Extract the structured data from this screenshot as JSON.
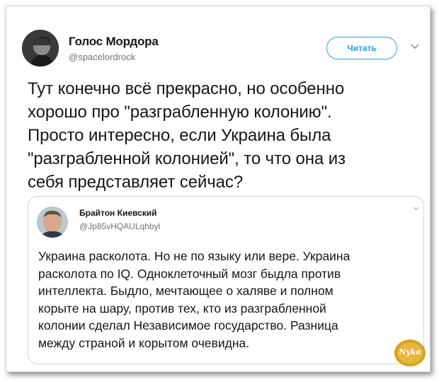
{
  "tweet": {
    "author_name": "Голос Мордора",
    "author_handle": "@spacelordrock",
    "follow_label": "Читать",
    "text": "Тут конечно всё прекрасно, но особенно\nхорошо про \"разграбленную колонию\".\nПросто интересно, если Украина была\n\"разграбленной колонией\", то что она из\nсебя представляет сейчас?"
  },
  "quoted_tweet": {
    "author_name": "Брайтон Киевский",
    "author_handle": "@Jp85vHQAULqhbyl",
    "text": "Украина расколота. Но не по языку или вере. Украина\nрасколота по IQ. Одноклеточный мозг быдла против\nинтеллекта. Быдло, мечтающее о халяве и полном\nкорыте на шару, против тех, кто из разграбленной\nколонии сделал Независимое государство. Разница\nмежду страной и корытом очевидна."
  },
  "watermark": {
    "text": "Nyka"
  },
  "colors": {
    "accent": "#1da1f2",
    "secondary_text": "#657786",
    "border": "#ccd6dd"
  },
  "icons": [
    "avatar",
    "chevron-down-icon",
    "watermark-logo"
  ]
}
